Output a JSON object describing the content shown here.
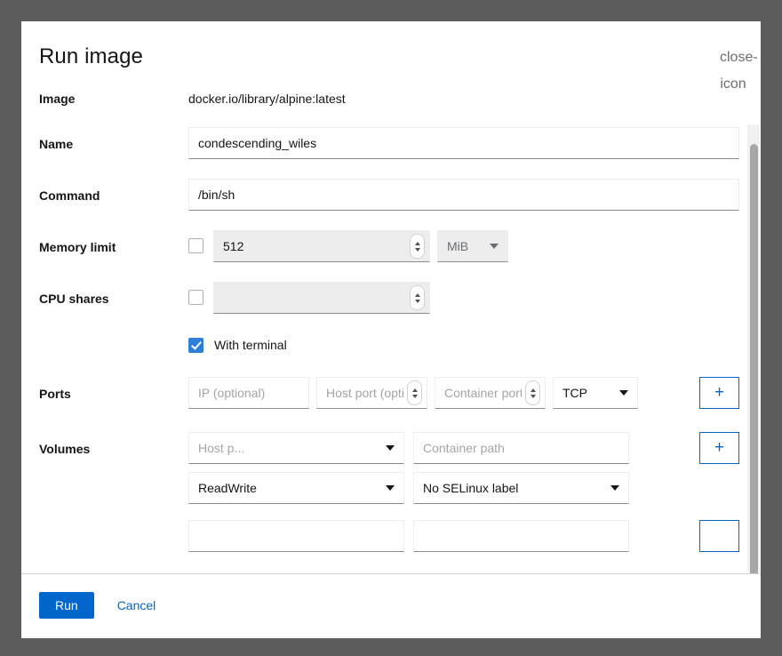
{
  "dialog": {
    "title": "Run image",
    "close_icon": "close-icon"
  },
  "fields": {
    "image": {
      "label": "Image",
      "value": "docker.io/library/alpine:latest"
    },
    "name": {
      "label": "Name",
      "value": "condescending_wiles"
    },
    "command": {
      "label": "Command",
      "value": "/bin/sh"
    },
    "memory_limit": {
      "label": "Memory limit",
      "enabled": false,
      "value": "512",
      "unit": "MiB"
    },
    "cpu_shares": {
      "label": "CPU shares",
      "enabled": false,
      "value": ""
    },
    "with_terminal": {
      "label": "With terminal",
      "checked": true
    },
    "ports": {
      "label": "Ports",
      "ip_placeholder": "IP (optional)",
      "host_port_placeholder": "Host port (optional)",
      "container_port_placeholder": "Container port",
      "protocol": "TCP",
      "add_label": "+"
    },
    "volumes": {
      "label": "Volumes",
      "host_path_placeholder": "Host p...",
      "container_path_placeholder": "Container path",
      "mode": "ReadWrite",
      "selinux": "No SELinux label",
      "add_label": "+"
    }
  },
  "footer": {
    "run_label": "Run",
    "cancel_label": "Cancel"
  },
  "colors": {
    "primary": "#0066cc",
    "checkbox": "#2f7ed8",
    "backdrop": "#5c5c5c"
  }
}
